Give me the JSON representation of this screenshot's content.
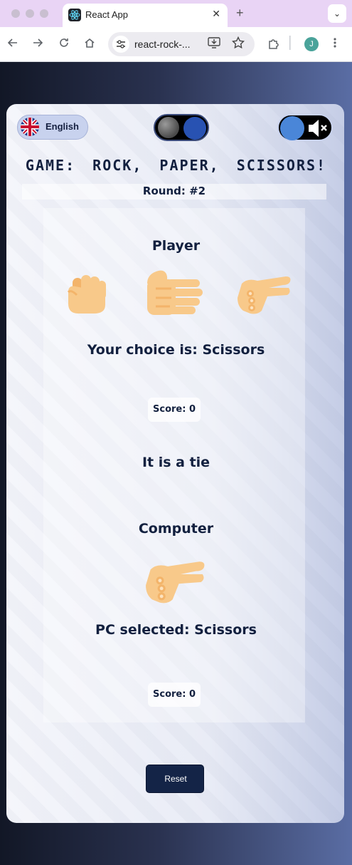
{
  "browser": {
    "tab_title": "React App",
    "tab_close_glyph": "✕",
    "new_tab_glyph": "+",
    "tab_menu_glyph": "⌄",
    "url": "react-rock-...",
    "profile_initial": "J",
    "icons": [
      "back-icon",
      "forward-icon",
      "reload-icon",
      "home-icon",
      "site-settings-icon",
      "install-icon",
      "bookmark-star-icon",
      "extensions-icon",
      "menu-icon"
    ]
  },
  "controls": {
    "language_label": "English",
    "theme": "dark",
    "sound": "muted"
  },
  "game": {
    "title": "GAME: ROCK, PAPER, SCISSORS!",
    "round_label": "Round: #2",
    "player": {
      "heading": "Player",
      "options": [
        "rock",
        "paper",
        "scissors"
      ],
      "choice_text": "Your choice is: Scissors",
      "score_text": "Score: 0"
    },
    "result_text": "It is a tie",
    "computer": {
      "heading": "Computer",
      "selection": "scissors",
      "choice_text": "PC selected: Scissors",
      "score_text": "Score: 0"
    },
    "reset_label": "Reset"
  },
  "colors": {
    "accent": "#142447",
    "text": "#12203f",
    "hand": "#f8c98a"
  }
}
